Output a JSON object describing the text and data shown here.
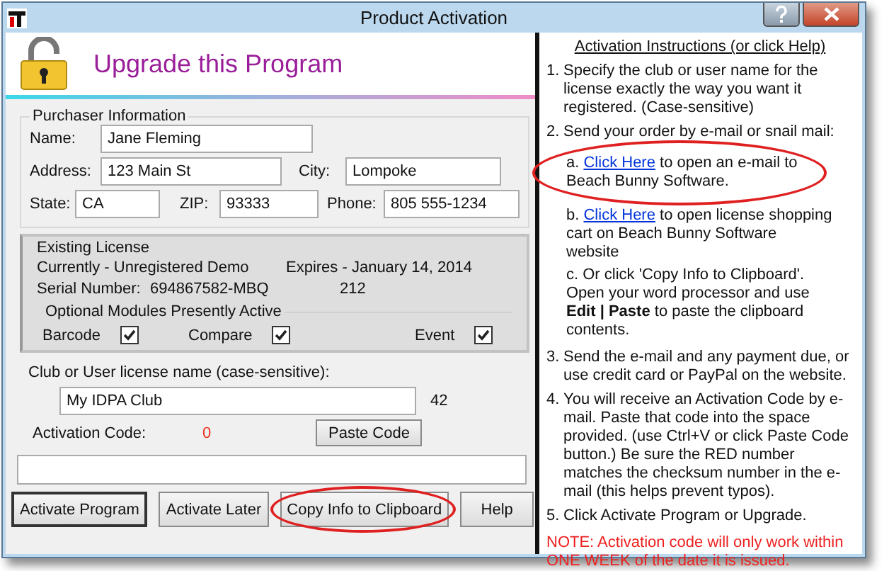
{
  "window": {
    "title": "Product Activation"
  },
  "header": {
    "title": "Upgrade this Program"
  },
  "purchaser": {
    "legend": "Purchaser Information",
    "fields": [
      {
        "label": "Name:",
        "value": "Jane Fleming"
      },
      {
        "label": "Address:",
        "value": "123 Main St"
      },
      {
        "label": "City:",
        "value": "Lompoke"
      },
      {
        "label": "State:",
        "value": "CA"
      },
      {
        "label": "ZIP:",
        "value": "93333"
      },
      {
        "label": "Phone:",
        "value": "805 555-1234"
      }
    ]
  },
  "license": {
    "legend": "Existing License",
    "status": "Currently - Unregistered Demo",
    "expires": "Expires - January 14, 2014",
    "serial_label": "Serial Number:",
    "serial": "694867582-MBQ",
    "serial_extra": "212",
    "modules_legend": "Optional Modules Presently Active",
    "modules": [
      {
        "name": "Barcode",
        "checked": true
      },
      {
        "name": "Compare",
        "checked": true
      },
      {
        "name": "Event",
        "checked": true
      }
    ]
  },
  "license_name": {
    "label": "Club or User license name (case-sensitive):",
    "value": "My IDPA Club",
    "count": "42"
  },
  "activation": {
    "label": "Activation Code:",
    "checksum": "0",
    "paste_button": "Paste Code"
  },
  "buttons": [
    {
      "label": "Activate Program",
      "default": true,
      "circled": false
    },
    {
      "label": "Activate Later",
      "default": false,
      "circled": false
    },
    {
      "label": "Copy Info to Clipboard",
      "default": false,
      "circled": true
    },
    {
      "label": "Help",
      "default": false,
      "circled": false
    }
  ],
  "instructions": {
    "title": "Activation Instructions (or click Help)",
    "steps": [
      {
        "number": "1.",
        "text": "Specify the club or user name for the license exactly the way you want it registered.  (Case-sensitive)"
      },
      {
        "number": "2.",
        "text": "Send your order by e-mail or snail mail:",
        "subitems": [
          {
            "letter": "a.",
            "link": "Click Here",
            "text": "to open an e-mail to Beach Bunny Software.",
            "circled": true
          },
          {
            "letter": "b.",
            "link": "Click Here",
            "text": "to open license shopping cart on Beach Bunny Software website",
            "circled": false
          },
          {
            "letter": "c.",
            "text": "Or click 'Copy Info to Clipboard'. Open your word processor and use **Edit | Paste** to paste the clipboard contents.",
            "circled": false
          }
        ]
      },
      {
        "number": "3.",
        "text": "Send the e-mail and any payment due, or use credit card or PayPal on the website."
      },
      {
        "number": "4.",
        "text": "You will receive an Activation Code by e-mail.  Paste that code into the space provided. (use Ctrl+V or click Paste Code button.)   Be sure the RED number matches the checksum number in the e-mail (this helps prevent typos)."
      },
      {
        "number": "5.",
        "text": "Click Activate Program or Upgrade."
      }
    ],
    "note": "NOTE: Activation code will only work within ONE WEEK of the date it is issued."
  }
}
